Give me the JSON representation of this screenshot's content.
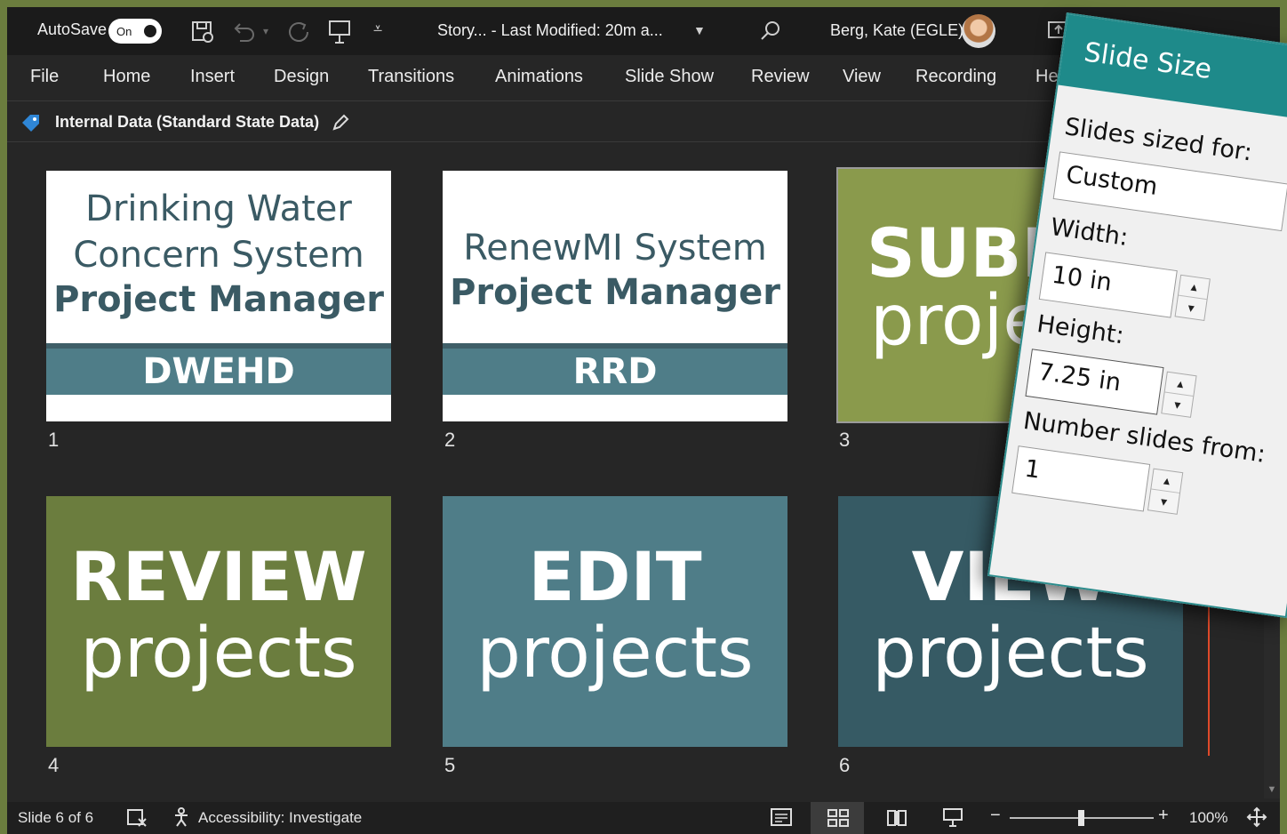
{
  "titlebar": {
    "autosave_label": "AutoSave",
    "autosave_state": "On",
    "doc_title": "Story...  -  Last Modified: 20m a...",
    "user_name": "Berg, Kate (EGLE)"
  },
  "ribbon": {
    "tabs": [
      "File",
      "Home",
      "Insert",
      "Design",
      "Transitions",
      "Animations",
      "Slide Show",
      "Review",
      "View",
      "Recording",
      "Help"
    ]
  },
  "sensitivity": {
    "label": "Internal Data (Standard State Data)"
  },
  "slides": [
    {
      "number": "1",
      "line1": "Drinking Water",
      "line2": "Concern System",
      "line3": "Project Manager",
      "band": "DWEHD"
    },
    {
      "number": "2",
      "line1": "RenewMI System",
      "line2": "Project Manager",
      "band": "RRD"
    },
    {
      "number": "3",
      "bold": "SUBMIT",
      "light": "projects"
    },
    {
      "number": "4",
      "bold": "REVIEW",
      "light": "projects"
    },
    {
      "number": "5",
      "bold": "EDIT",
      "light": "projects"
    },
    {
      "number": "6",
      "bold": "VIEW",
      "light": "projects"
    }
  ],
  "colors": {
    "olive_light": "#8a9a4c",
    "olive_dark": "#6b7d3e",
    "teal": "#4f7d88",
    "dark_teal": "#365a64",
    "dialog_header": "#1e8a8a"
  },
  "statusbar": {
    "slide_info": "Slide 6 of 6",
    "accessibility": "Accessibility: Investigate",
    "zoom": "100%"
  },
  "dialog": {
    "title": "Slide Size",
    "slides_sized_label": "Slides sized for:",
    "slides_sized_value": "Custom",
    "width_label": "Width:",
    "width_value": "10 in",
    "height_label": "Height:",
    "height_value": "7.25 in",
    "number_slides_label": "Number slides from:",
    "number_slides_value": "1"
  }
}
